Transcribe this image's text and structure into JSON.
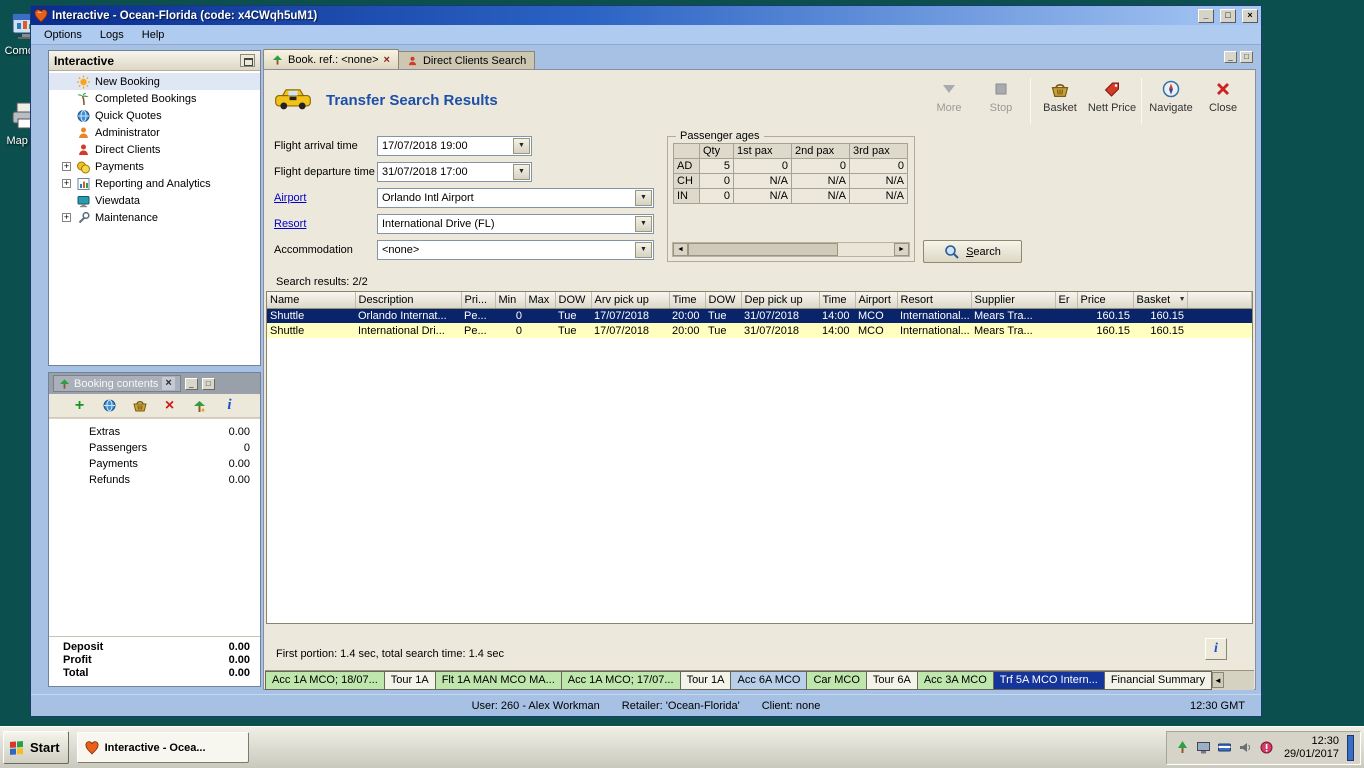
{
  "colors": {
    "desktop": "#0c4f4f",
    "titlebar_start": "#0a2d8e",
    "selected_row": "#0a246a",
    "alt_row": "#ffffc0",
    "tab_green": "#bfe6ac",
    "tab_blue": "#b9cfe9",
    "tab_selected": "#15359b",
    "title_accent": "#1d4fa8",
    "link": "#0000cc"
  },
  "icons": {
    "arrow_down": "▼",
    "close_x": "×",
    "plus": "+",
    "left_arrow": "◄",
    "right_arrow": "►",
    "info": "i",
    "minimize": "_",
    "maximize": "□"
  },
  "desktop": {
    "icons": [
      {
        "label": "Como St"
      },
      {
        "label": "Map My"
      }
    ]
  },
  "window": {
    "title": "Interactive - Ocean-Florida (code: x4CWqh5uM1)",
    "menu": [
      {
        "label": "Options"
      },
      {
        "label": "Logs"
      },
      {
        "label": "Help"
      }
    ]
  },
  "sidebar": {
    "title": "Interactive",
    "items": [
      {
        "label": "New Booking"
      },
      {
        "label": "Completed Bookings"
      },
      {
        "label": "Quick Quotes"
      },
      {
        "label": "Administrator"
      },
      {
        "label": "Direct Clients"
      },
      {
        "label": "Payments"
      },
      {
        "label": "Reporting and Analytics"
      },
      {
        "label": "Viewdata"
      },
      {
        "label": "Maintenance"
      }
    ]
  },
  "booking": {
    "title": "Booking contents",
    "rows": [
      {
        "label": "Extras",
        "value": "0.00"
      },
      {
        "label": "Passengers",
        "value": "0"
      },
      {
        "label": "Payments",
        "value": "0.00"
      },
      {
        "label": "Refunds",
        "value": "0.00"
      }
    ],
    "totals": [
      {
        "label": "Deposit",
        "value": "0.00"
      },
      {
        "label": "Profit",
        "value": "0.00"
      },
      {
        "label": "Total",
        "value": "0.00"
      }
    ]
  },
  "doc": {
    "tabs": [
      {
        "label": "Book. ref.: <none>"
      },
      {
        "label": "Direct Clients Search"
      }
    ],
    "title": "Transfer Search Results",
    "toolbar": [
      {
        "label": "More",
        "disabled": true
      },
      {
        "label": "Stop",
        "disabled": true
      },
      {
        "label": "Basket",
        "disabled": false
      },
      {
        "label": "Nett Price",
        "disabled": false
      },
      {
        "label": "Navigate",
        "disabled": false
      },
      {
        "label": "Close",
        "disabled": false
      }
    ],
    "form": [
      {
        "label": "Flight arrival time",
        "value": "17/07/2018 19:00"
      },
      {
        "label": "Flight departure time",
        "value": "31/07/2018 17:00"
      },
      {
        "label": "Airport",
        "value": "Orlando Intl Airport"
      },
      {
        "label": "Resort",
        "value": "International Drive (FL)"
      },
      {
        "label": "Accommodation",
        "value": "<none>"
      }
    ],
    "passenger_ages": {
      "title": "Passenger ages",
      "columns": [
        "",
        "Qty",
        "1st pax",
        "2nd pax",
        "3rd pax"
      ],
      "rows": [
        {
          "cells": [
            "AD",
            "5",
            "0",
            "0",
            "0"
          ]
        },
        {
          "cells": [
            "CH",
            "0",
            "N/A",
            "N/A",
            "N/A"
          ]
        },
        {
          "cells": [
            "IN",
            "0",
            "N/A",
            "N/A",
            "N/A"
          ]
        }
      ]
    },
    "search_button": "Search",
    "results_label": "Search results: 2/2",
    "grid": {
      "columns": [
        "Name",
        "Description",
        "Pri...",
        "Min",
        "Max",
        "DOW",
        "Arv pick up",
        "Time",
        "DOW",
        "Dep pick up",
        "Time",
        "Airport",
        "Resort",
        "Supplier",
        "Er",
        "Price",
        "Basket"
      ],
      "rows": [
        {
          "cells": [
            "Shuttle",
            "Orlando Internat...",
            "Pe...",
            "0",
            "",
            "Tue",
            "17/07/2018",
            "20:00",
            "Tue",
            "31/07/2018",
            "14:00",
            "MCO",
            "International...",
            "Mears Tra...",
            "",
            "160.15",
            "160.15"
          ]
        },
        {
          "cells": [
            "Shuttle",
            "International Dri...",
            "Pe...",
            "0",
            "",
            "Tue",
            "17/07/2018",
            "20:00",
            "Tue",
            "31/07/2018",
            "14:00",
            "MCO",
            "International...",
            "Mears Tra...",
            "",
            "160.15",
            "160.15"
          ]
        }
      ]
    },
    "status_text": "First portion: 1.4 sec, total search time: 1.4 sec",
    "bottom_tabs": [
      {
        "label": "Acc 1A MCO; 18/07..."
      },
      {
        "label": "Tour 1A"
      },
      {
        "label": "Flt 1A MAN MCO MA..."
      },
      {
        "label": "Acc 1A MCO; 17/07..."
      },
      {
        "label": "Tour 1A"
      },
      {
        "label": "Acc 6A MCO"
      },
      {
        "label": "Car MCO"
      },
      {
        "label": "Tour 6A"
      },
      {
        "label": "Acc 3A MCO"
      },
      {
        "label": "Trf 5A MCO Intern..."
      },
      {
        "label": "Financial Summary"
      }
    ]
  },
  "statusbar": {
    "user": "User: 260 - Alex Workman",
    "retailer": "Retailer: 'Ocean-Florida'",
    "client": "Client: none",
    "time": "12:30 GMT"
  },
  "taskbar": {
    "start_label": "Start",
    "task_label": "Interactive - Ocea...",
    "clock_time": "12:30",
    "clock_date": "29/01/2017"
  }
}
